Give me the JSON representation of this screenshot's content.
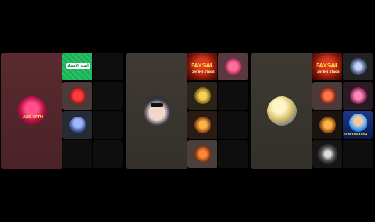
{
  "tiles": {
    "b1_main_text": "ADS KATM",
    "b1_cell1_text": "أغنية الأستاذ",
    "b2_top_banner": "FAYSAL",
    "b2_top_sub": "ON THE STAGE",
    "b3_top_banner": "FAYSAL",
    "b3_top_sub": "ON THE STAGE",
    "b3_right_banner": "VOICEWALLAH"
  },
  "colors": {
    "board1_main": "#52262b",
    "board2_main": "#3c3631",
    "board3_main": "#3a3630",
    "green_tile": "#12b353"
  }
}
